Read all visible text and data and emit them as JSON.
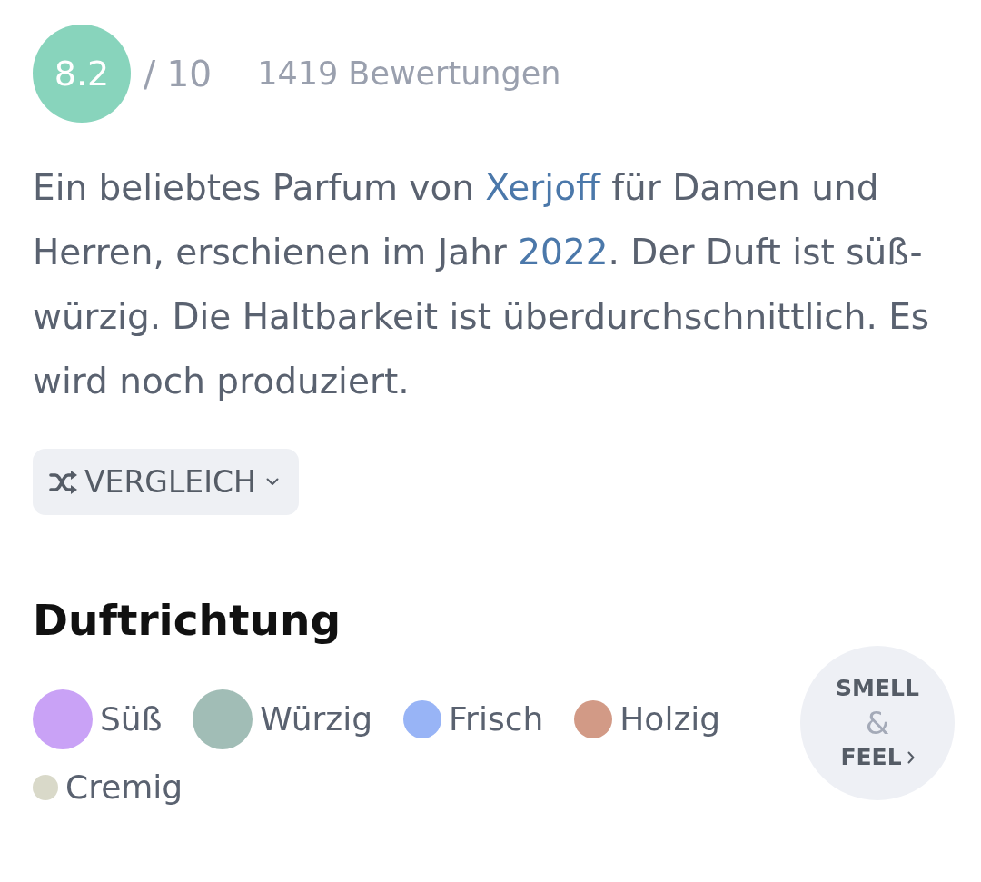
{
  "rating": {
    "score": "8.2",
    "scale": "/ 10",
    "count": "1419 Bewertungen"
  },
  "description": [
    {
      "kind": "text",
      "text": "Ein beliebtes Parfum von "
    },
    {
      "kind": "link",
      "text": "Xerjoff"
    },
    {
      "kind": "text",
      "text": " für Damen und Herren, erschienen im Jahr "
    },
    {
      "kind": "link",
      "text": "2022"
    },
    {
      "kind": "text",
      "text": ". Der Duft ist süß-würzig. Die Haltbarkeit ist überdurchschnittlich. Es wird noch produziert."
    }
  ],
  "compare_button": {
    "label": "VERGLEICH"
  },
  "scent_section": {
    "title": "Duftrichtung"
  },
  "accords": [
    {
      "kind": "large",
      "name": "Süß",
      "color": "#c9a2f6"
    },
    {
      "kind": "large",
      "name": "Würzig",
      "color": "#a1bdb6"
    },
    {
      "kind": "medium",
      "name": "Frisch",
      "color": "#98b4f6"
    },
    {
      "kind": "medium",
      "name": "Holzig",
      "color": "#d29a86"
    },
    {
      "kind": "small",
      "name": "Cremig",
      "color": "#d9d9c9"
    }
  ],
  "smell_feel_button": {
    "line_1": "SMELL",
    "line_2": "&",
    "line_3": "FEEL"
  }
}
